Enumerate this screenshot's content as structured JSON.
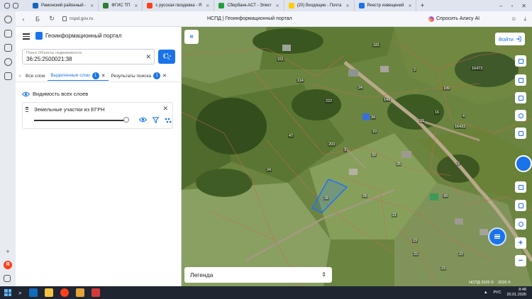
{
  "browser": {
    "tabs": [
      {
        "label": "Рамонский районный -",
        "color": "#1565c0"
      },
      {
        "label": "ФГИС ТП",
        "color": "#2e7d32"
      },
      {
        "label": "с русская гвоздевка - Я",
        "color": "#fc3f1d"
      },
      {
        "label": "Сбербанк-АСТ - Элект",
        "color": "#21a038"
      },
      {
        "label": "(20) Входящие - Почта",
        "color": "#ffcc00"
      },
      {
        "label": "Реестр извещений",
        "color": "#1a73e8"
      }
    ],
    "url": "nspd.gov.ru",
    "page_title": "НСПД | Геоинформационный портал",
    "alice_label": "Спросить Алису AI"
  },
  "portal": {
    "title": "Геоинформационный портал",
    "search": {
      "label": "Поиск Объекты недвижимости",
      "value": "36:25:2500021:38"
    },
    "tabs": [
      {
        "label": "Все слои",
        "badge": "",
        "active": false
      },
      {
        "label": "Выделенные слои",
        "badge": "1",
        "active": true
      },
      {
        "label": "Результаты поиска",
        "badge": "1",
        "active": false
      }
    ],
    "visibility_label": "Видимость всех слоев",
    "layer": {
      "name": "Земельные участки из ЕГРН",
      "opacity": 1.0
    }
  },
  "map": {
    "login_label": "Войти",
    "legend_label": "Легенда",
    "copyright": [
      "НСПД 2026 ©",
      "2026 ©"
    ],
    "parcel_numbers": [
      "151",
      "181",
      "2",
      "114",
      "24",
      "16473",
      "143",
      "34",
      "199",
      "10",
      "23",
      "16",
      "4",
      "47",
      "222",
      "31",
      "16433",
      "24",
      "203",
      "3",
      "28",
      "32",
      "4",
      "25",
      "2",
      "28",
      "29",
      "21",
      "43",
      "23",
      "22",
      "23",
      "22"
    ]
  },
  "taskbar": {
    "time": "8:48",
    "date": "20.01.2026",
    "lang": "РУС"
  },
  "colors": {
    "accent": "#1a73e8",
    "selected_parcel": "#1e6fff"
  }
}
